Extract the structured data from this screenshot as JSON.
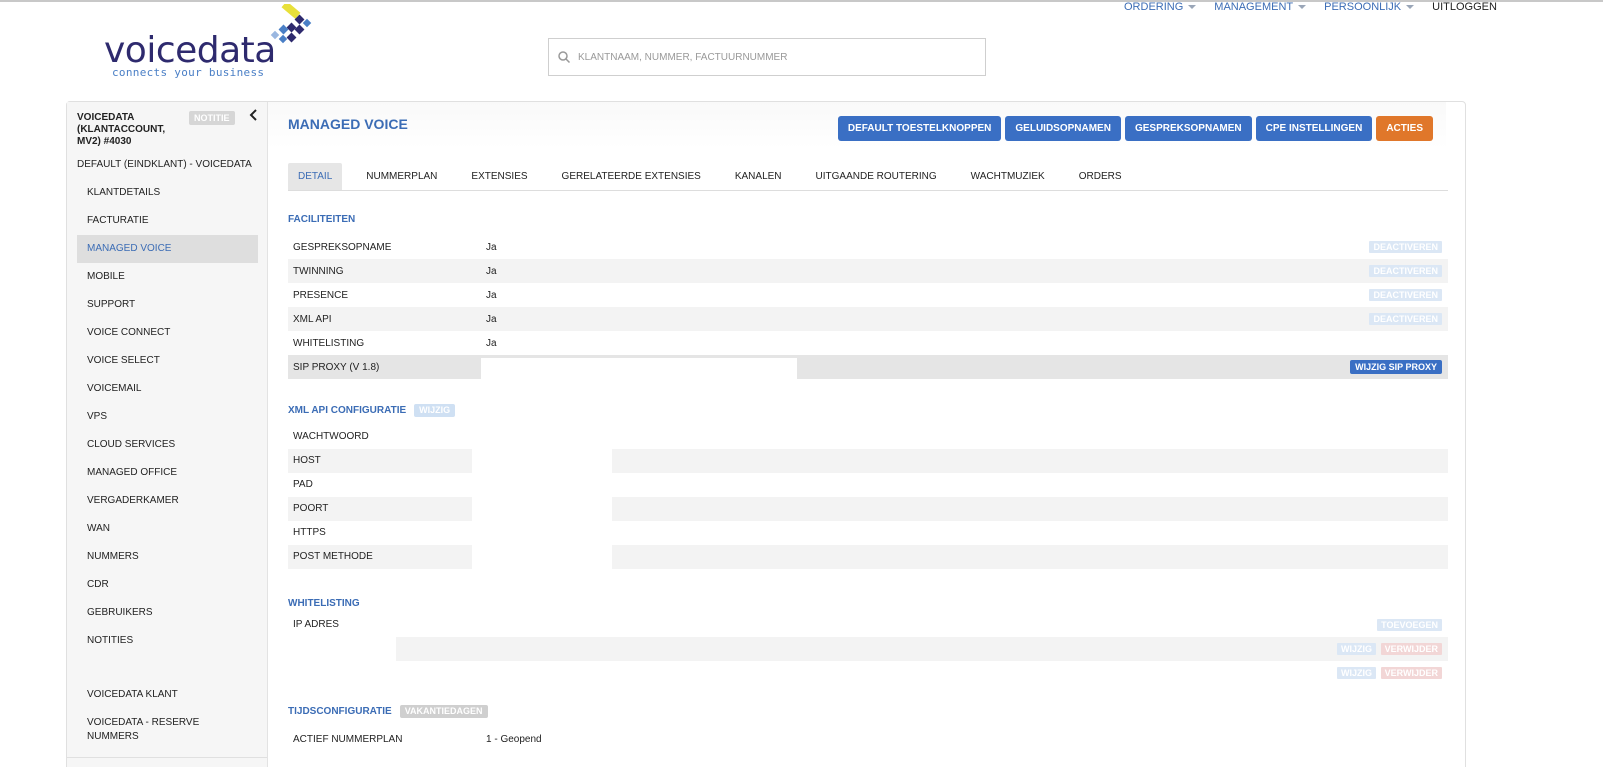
{
  "brand": {
    "name": "voicedata",
    "tagline": "connects your business"
  },
  "topnav": {
    "items": [
      "ORDERING",
      "MANAGEMENT",
      "PERSOONLIJK"
    ],
    "logout": "UITLOGGEN"
  },
  "search": {
    "placeholder": "KLANTNAAM, NUMMER, FACTUURNUMMER"
  },
  "sidebar": {
    "account": "VOICEDATA (KLANTACCOUNT, MV2) #4030",
    "note_button": "NOTITIE",
    "sub_account": "DEFAULT (EINDKLANT) - VOICEDATA",
    "items": [
      "KLANTDETAILS",
      "FACTURATIE",
      "MANAGED VOICE",
      "MOBILE",
      "SUPPORT",
      "VOICE CONNECT",
      "VOICE SELECT",
      "VOICEMAIL",
      "VPS",
      "CLOUD SERVICES",
      "MANAGED OFFICE",
      "VERGADERKAMER",
      "WAN",
      "NUMMERS",
      "CDR",
      "GEBRUIKERS",
      "NOTITIES"
    ],
    "active": "MANAGED VOICE",
    "extra": [
      "VOICEDATA KLANT",
      "VOICEDATA - RESERVE NUMMERS"
    ]
  },
  "main": {
    "title": "MANAGED VOICE",
    "actions": [
      "DEFAULT TOESTELKNOPPEN",
      "GELUIDSOPNAMEN",
      "GESPREKSOPNAMEN",
      "CPE INSTELLINGEN",
      "ACTIES"
    ],
    "tabs": [
      "DETAIL",
      "NUMMERPLAN",
      "EXTENSIES",
      "GERELATEERDE EXTENSIES",
      "KANALEN",
      "UITGAANDE ROUTERING",
      "WACHTMUZIEK",
      "ORDERS"
    ],
    "active_tab": "DETAIL"
  },
  "faciliteiten": {
    "title": "FACILITEITEN",
    "rows": [
      {
        "label": "GESPREKSOPNAME",
        "value": "Ja",
        "action": "DEACTIVEREN"
      },
      {
        "label": "TWINNING",
        "value": "Ja",
        "action": "DEACTIVEREN"
      },
      {
        "label": "PRESENCE",
        "value": "Ja",
        "action": "DEACTIVEREN"
      },
      {
        "label": "XML API",
        "value": "Ja",
        "action": "DEACTIVEREN"
      },
      {
        "label": "WHITELISTING",
        "value": "Ja",
        "action": ""
      }
    ],
    "sip": {
      "label": "SIP PROXY (V 1.8)",
      "action": "WIJZIG SIP PROXY"
    }
  },
  "xml_api": {
    "title": "XML API CONFIGURATIE",
    "edit": "WIJZIG",
    "rows": [
      "WACHTWOORD",
      "HOST",
      "PAD",
      "POORT",
      "HTTPS",
      "POST METHODE"
    ]
  },
  "whitelisting": {
    "title": "WHITELISTING",
    "label": "IP ADRES",
    "add": "TOEVOEGEN",
    "edit": "WIJZIG",
    "remove": "VERWIJDER"
  },
  "tijd": {
    "title": "TIJDSCONFIGURATIE",
    "button": "VAKANTIEDAGEN",
    "row": {
      "label": "ACTIEF NUMMERPLAN",
      "value": "1 - Geopend"
    }
  },
  "colors": {
    "primary": "#3a6fc4",
    "accent": "#e0772a",
    "link": "#3b6cb5"
  }
}
